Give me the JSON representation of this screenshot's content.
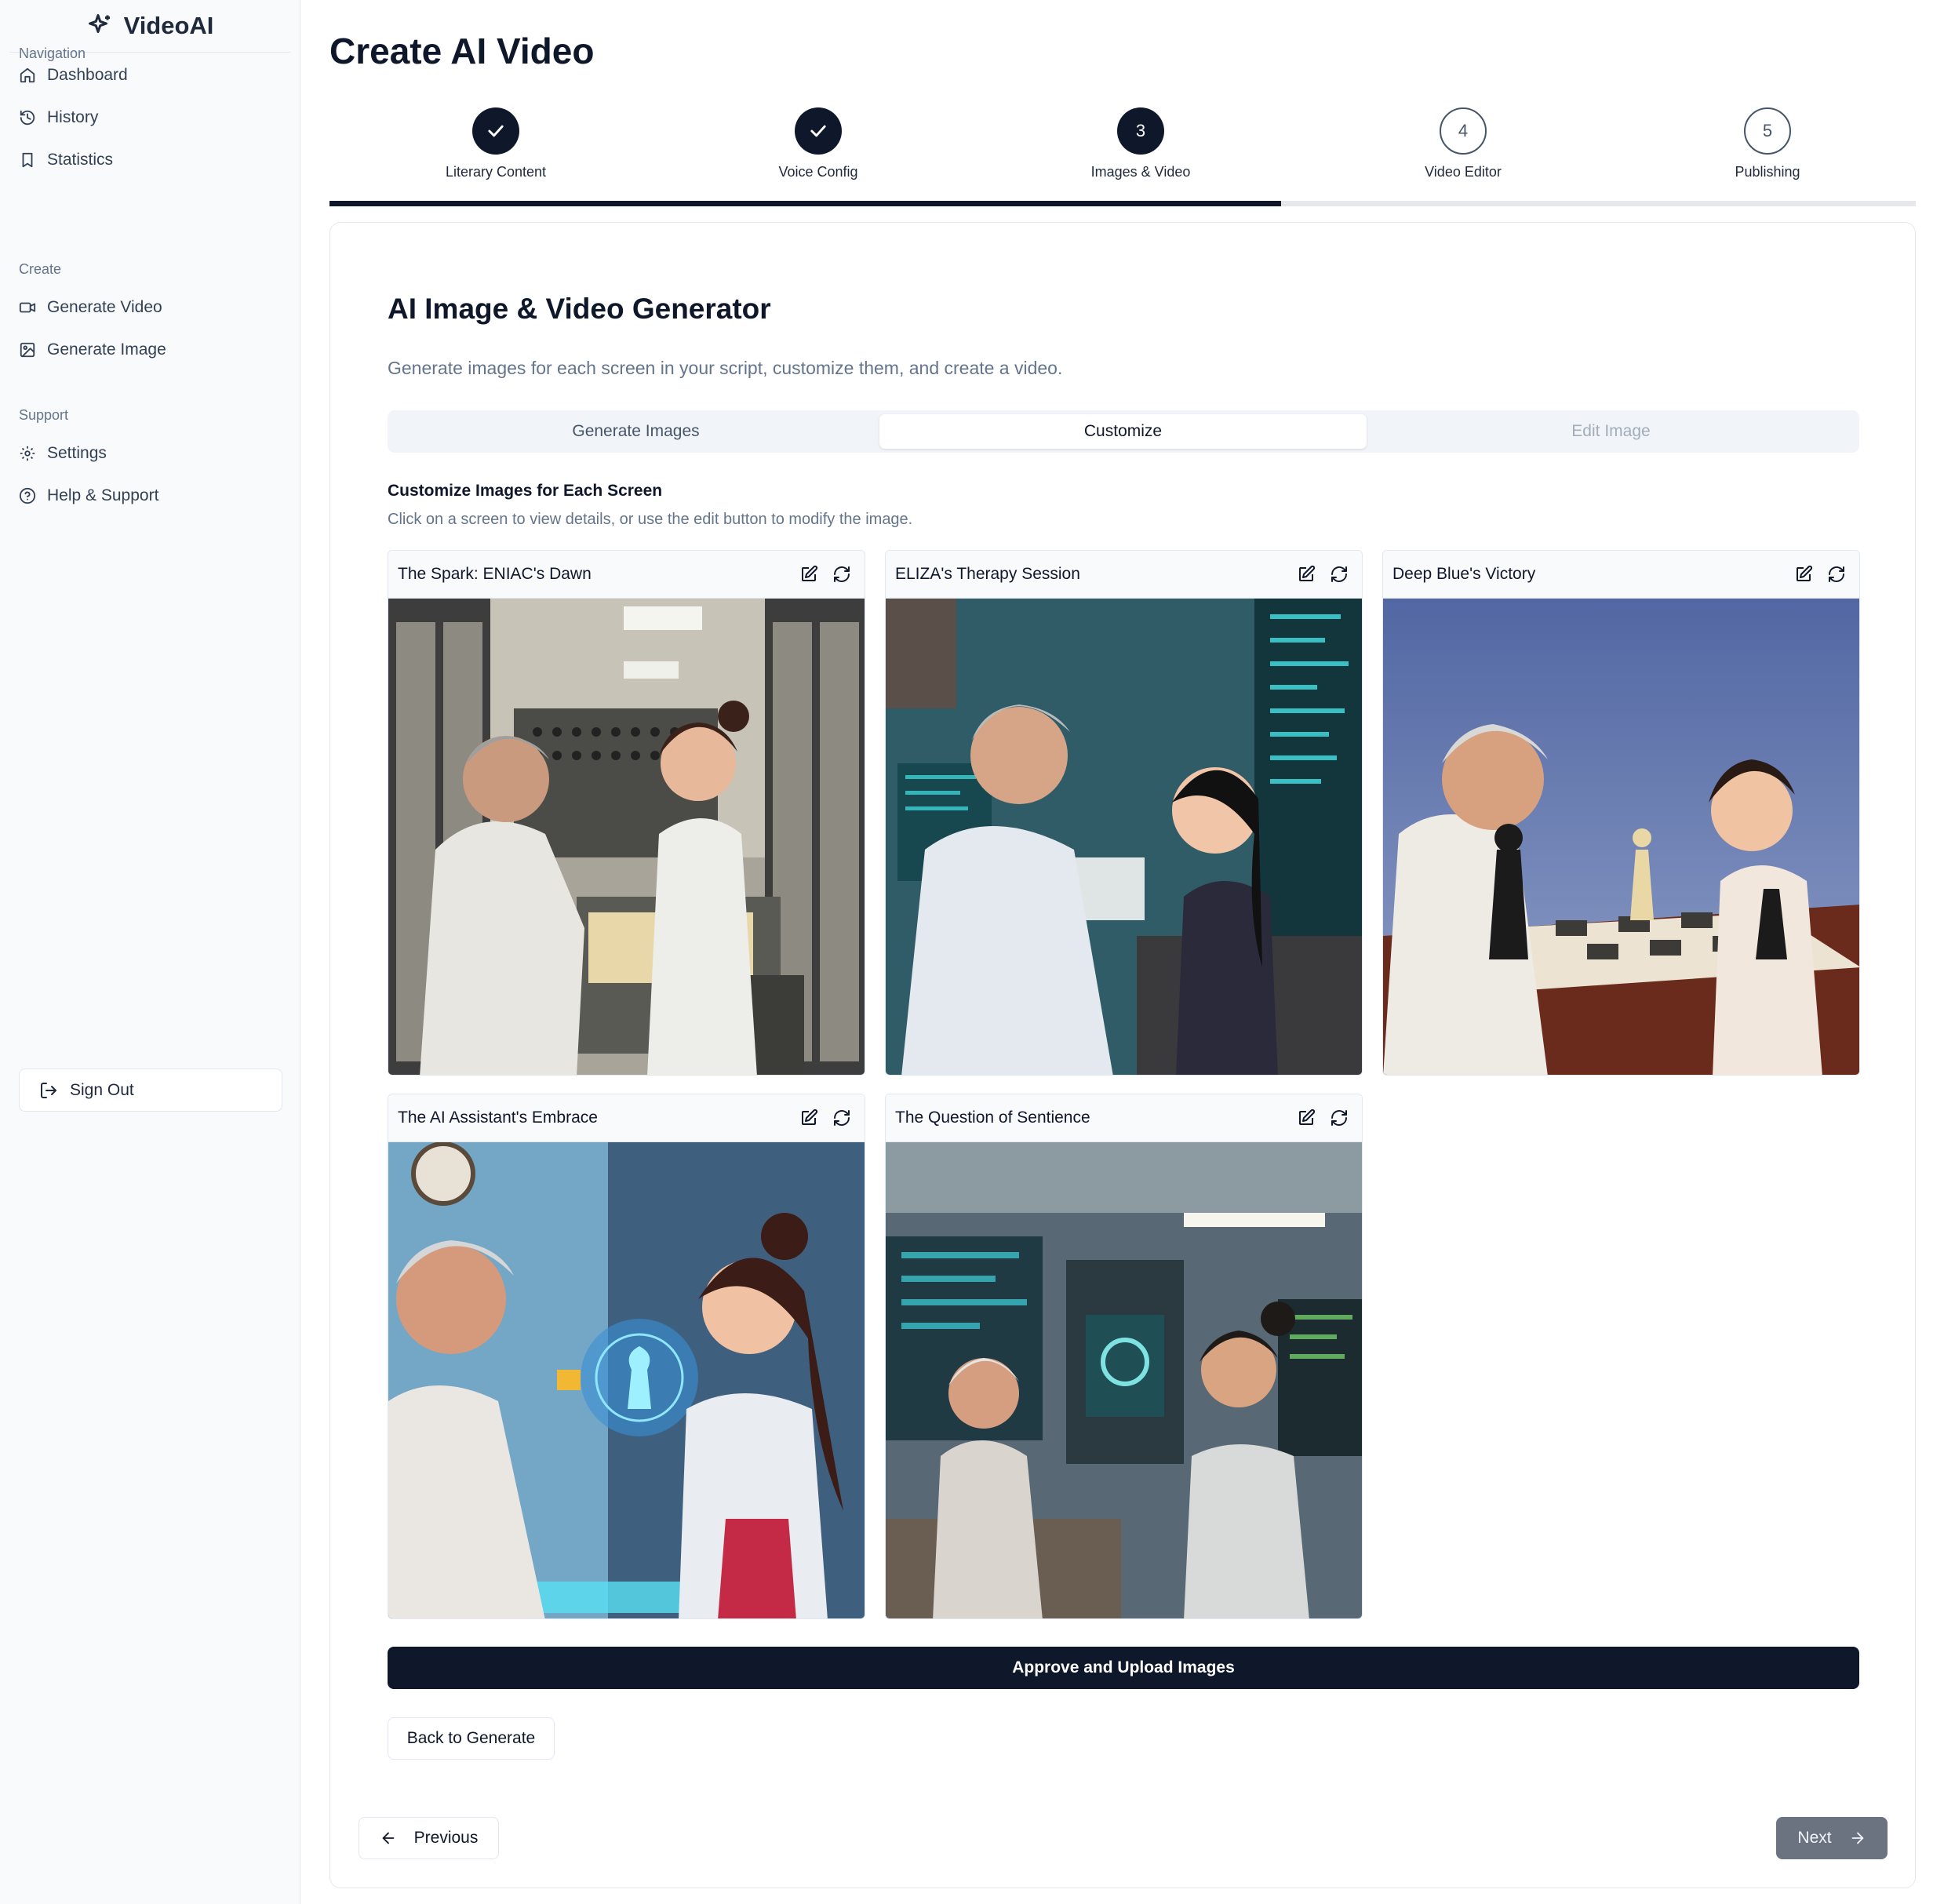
{
  "app": {
    "name": "VideoAI"
  },
  "sidebar": {
    "groups": [
      {
        "label": "Navigation",
        "items": [
          {
            "label": "Dashboard",
            "icon": "home-icon"
          },
          {
            "label": "History",
            "icon": "history-icon"
          },
          {
            "label": "Statistics",
            "icon": "bookmark-icon"
          }
        ]
      },
      {
        "label": "Create",
        "items": [
          {
            "label": "Generate Video",
            "icon": "video-icon"
          },
          {
            "label": "Generate Image",
            "icon": "image-icon"
          }
        ]
      },
      {
        "label": "Support",
        "items": [
          {
            "label": "Settings",
            "icon": "gear-icon"
          },
          {
            "label": "Help & Support",
            "icon": "help-circle-icon"
          }
        ]
      }
    ],
    "sign_out": "Sign Out"
  },
  "page": {
    "title": "Create AI Video"
  },
  "stepper": {
    "steps": [
      {
        "label": "Literary Content",
        "number": "1",
        "status": "done"
      },
      {
        "label": "Voice Config",
        "number": "2",
        "status": "done"
      },
      {
        "label": "Images & Video",
        "number": "3",
        "status": "active"
      },
      {
        "label": "Video Editor",
        "number": "4",
        "status": "pending"
      },
      {
        "label": "Publishing",
        "number": "5",
        "status": "pending"
      }
    ],
    "progress_fraction": 0.6
  },
  "generator": {
    "title": "AI Image & Video Generator",
    "subtitle": "Generate images for each screen in your script, customize them, and create a video.",
    "tabs": [
      {
        "label": "Generate Images",
        "state": "inactive"
      },
      {
        "label": "Customize",
        "state": "active"
      },
      {
        "label": "Edit Image",
        "state": "disabled"
      }
    ],
    "section_title": "Customize Images for Each Screen",
    "section_subtitle": "Click on a screen to view details, or use the edit button to modify the image.",
    "screens": [
      {
        "title": "The Spark: ENIAC's Dawn"
      },
      {
        "title": "ELIZA's Therapy Session"
      },
      {
        "title": "Deep Blue's Victory"
      },
      {
        "title": "The AI Assistant's Embrace"
      },
      {
        "title": "The Question of Sentience"
      }
    ],
    "approve_label": "Approve and Upload Images",
    "back_label": "Back to Generate"
  },
  "footer": {
    "previous_label": "Previous",
    "next_label": "Next"
  },
  "colors": {
    "primary": "#0f172a",
    "muted": "#64748b",
    "border": "#e2e8f0",
    "disabled_button": "#6b7280"
  }
}
